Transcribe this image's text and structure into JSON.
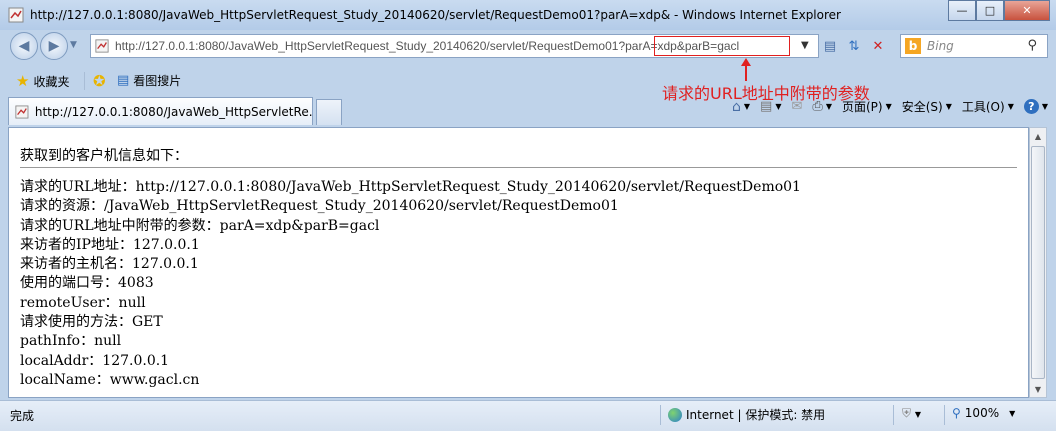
{
  "window": {
    "title": "http://127.0.0.1:8080/JavaWeb_HttpServletRequest_Study_20140620/servlet/RequestDemo01?parA=xdp& - Windows Internet Explorer"
  },
  "address_bar": {
    "url_prefix": "http://127.0.0.1:8080/JavaWeb_HttpServletRequest_Study_20140620/servlet/RequestDemo01?",
    "url_query": "parA=xdp&parB=gacl"
  },
  "search": {
    "placeholder": "Bing"
  },
  "favorites": {
    "favorites_label": "收藏夹",
    "suggested_label": "看图搜片"
  },
  "tab": {
    "label": "http://127.0.0.1:8080/JavaWeb_HttpServletRe..."
  },
  "command_bar": {
    "page_label": "页面(P)",
    "safety_label": "安全(S)",
    "tools_label": "工具(O)"
  },
  "annotation": {
    "text": "请求的URL地址中附带的参数",
    "color": "#e02020"
  },
  "page": {
    "heading": "获取到的客户机信息如下：",
    "lines": [
      "请求的URL地址：http://127.0.0.1:8080/JavaWeb_HttpServletRequest_Study_20140620/servlet/RequestDemo01",
      "请求的资源：/JavaWeb_HttpServletRequest_Study_20140620/servlet/RequestDemo01",
      "请求的URL地址中附带的参数：parA=xdp&parB=gacl",
      "来访者的IP地址：127.0.0.1",
      "来访者的主机名：127.0.0.1",
      "使用的端口号：4083",
      "remoteUser：null",
      "请求使用的方法：GET",
      "pathInfo：null",
      "localAddr：127.0.0.1",
      "localName：www.gacl.cn"
    ]
  },
  "status_bar": {
    "status": "完成",
    "zone": "Internet | 保护模式: 禁用",
    "zoom": "100%"
  }
}
